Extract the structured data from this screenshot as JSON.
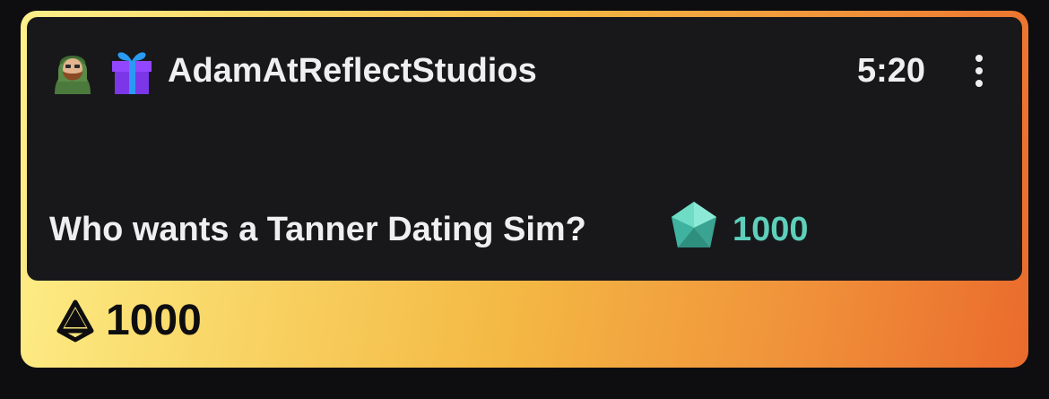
{
  "header": {
    "avatar_icon": "hooded-bearded-man-avatar-icon",
    "gift_icon": "gift-badge-icon",
    "username": "AdamAtReflectStudios",
    "time": "5:20",
    "more_icon": "kebab-menu-icon"
  },
  "message": {
    "text": "Who wants a Tanner Dating Sim?",
    "gem_icon": "gem-icon",
    "amount": "1000"
  },
  "footer": {
    "points_icon": "channel-points-icon",
    "points": "1000"
  },
  "colors": {
    "gradient_start": "#fdf08a",
    "gradient_end": "#ea6b2c",
    "card_bg": "#18181b",
    "gem_teal": "#5ecfbb",
    "gift_purple": "#9147ff"
  }
}
